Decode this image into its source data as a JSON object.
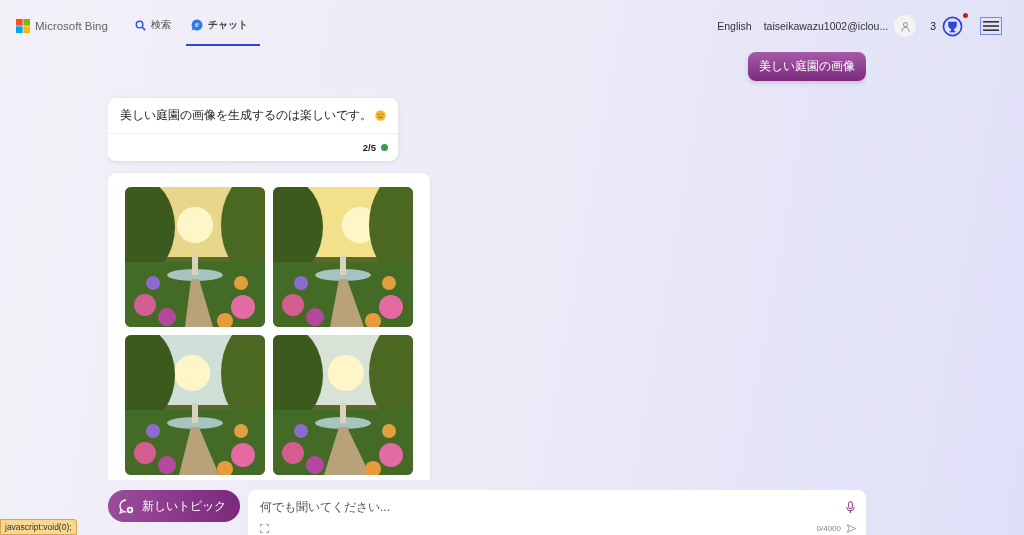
{
  "header": {
    "brand": "Microsoft Bing",
    "nav": [
      {
        "label": "検索",
        "selected": false
      },
      {
        "label": "チャット",
        "selected": true
      }
    ],
    "language": "English",
    "account": "taiseikawazu1002@iclou...",
    "rewards_count": "3",
    "rewards_notification": true
  },
  "user_message": "美しい庭園の画像",
  "bot_message": {
    "text": "美しい庭園の画像を生成するのは楽しいです。",
    "turn_counter": "2/5",
    "color": "#3c9a4c"
  },
  "new_topic_button": "新しいトピック",
  "input": {
    "placeholder": "何でも聞いてください...",
    "char_count": "0/4000"
  },
  "status_tooltip": "javascript:void(0);"
}
